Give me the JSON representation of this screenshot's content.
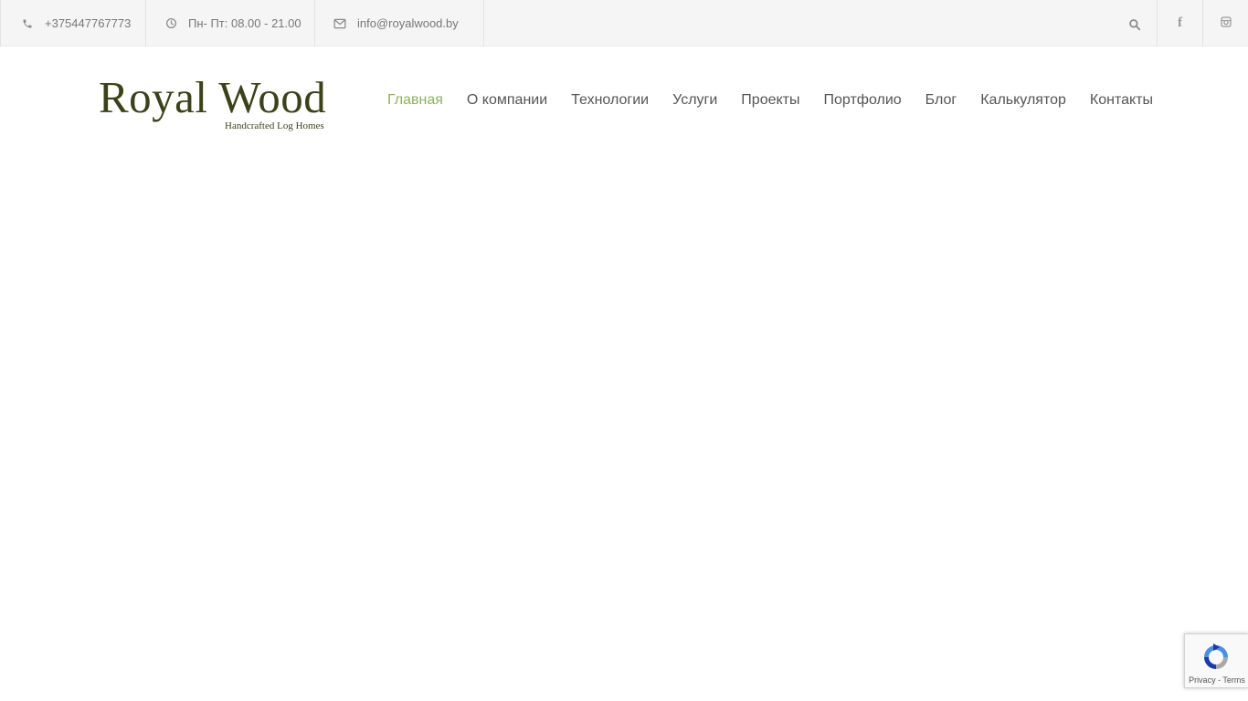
{
  "topbar": {
    "phone": "+375447767773",
    "hours": "Пн- Пт: 08.00 - 21.00",
    "email": "info@royalwood.by",
    "icons": {
      "phone": "phone-icon",
      "hours": "clock-icon",
      "email": "envelope-icon",
      "search": "search-icon",
      "facebook": "facebook-icon",
      "instagram": "instagram-icon"
    }
  },
  "logo": {
    "title": "Royal Wood",
    "subtitle": "Handcrafted Log Homes"
  },
  "nav": {
    "items": [
      {
        "label": "Главная"
      },
      {
        "label": "О компании"
      },
      {
        "label": "Технологии"
      },
      {
        "label": "Услуги"
      },
      {
        "label": "Проекты"
      },
      {
        "label": "Портфолио"
      },
      {
        "label": "Блог"
      },
      {
        "label": "Калькулятор"
      },
      {
        "label": "Контакты"
      }
    ],
    "active_color": "#8cb35a"
  },
  "recaptcha": {
    "privacy": "Privacy",
    "separator": " - ",
    "terms": "Terms"
  },
  "colors": {
    "brand": "#3b4219",
    "accent": "#8cb35a",
    "topbar_bg": "#f5f5f5"
  }
}
